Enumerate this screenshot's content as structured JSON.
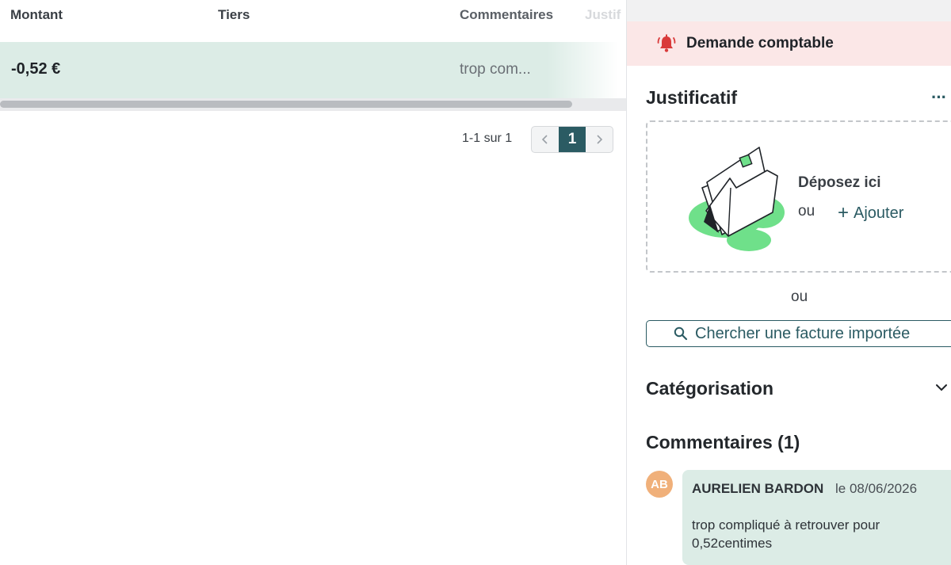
{
  "table": {
    "headers": [
      "Montant",
      "Tiers",
      "Commentaires",
      "Justif"
    ],
    "rows": [
      {
        "montant": "-0,52 €",
        "tiers": "",
        "commentaire": "trop com..."
      }
    ]
  },
  "pagination": {
    "info": "1-1 sur 1",
    "current_page": "1"
  },
  "panel": {
    "alert": "Demande comptable",
    "justificatif": {
      "title": "Justificatif",
      "more": "···",
      "drop_text": "Déposez ici",
      "or_text": "ou",
      "add_label": "Ajouter",
      "or_between": "ou",
      "search_label": "Chercher une facture importée"
    },
    "categorisation": {
      "title": "Catégorisation"
    },
    "comments": {
      "title": "Commentaires (1)",
      "items": [
        {
          "initials": "AB",
          "author": "AURELIEN BARDON",
          "date": "le 08/06/2026",
          "body": "trop compliqué à retrouver pour 0,52centimes"
        }
      ]
    }
  },
  "colors": {
    "accent": "#2b5b63",
    "row_highlight": "#dcece6",
    "alert_bg": "#fbe7e7",
    "alert_icon": "#d93a3a",
    "avatar": "#f0b07a",
    "illustration_green": "#6fe08a"
  },
  "icons": [
    "bell-alert-icon",
    "chevron-left-icon",
    "chevron-right-icon",
    "plus-icon",
    "search-icon",
    "chevron-down-icon",
    "document-upload-illustration"
  ]
}
